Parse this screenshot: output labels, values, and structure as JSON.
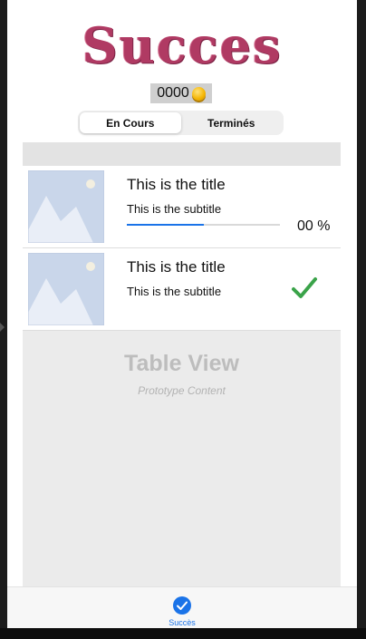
{
  "app": {
    "title": "Succes"
  },
  "coins": {
    "value": "0000",
    "icon": "coin-icon"
  },
  "segmented": {
    "items": [
      {
        "label": "En Cours",
        "active": true
      },
      {
        "label": "Terminés",
        "active": false
      }
    ]
  },
  "table": {
    "rows": [
      {
        "title": "This is the title",
        "subtitle": "This is the subtitle",
        "progress": 0.5,
        "percent_label": "00 %",
        "status": "in-progress"
      },
      {
        "title": "This is the title",
        "subtitle": "This is the subtitle",
        "status": "completed",
        "icon": "checkmark-icon"
      }
    ],
    "placeholder": {
      "title": "Table View",
      "subtitle": "Prototype Content"
    }
  },
  "tabbar": {
    "items": [
      {
        "label": "Succès",
        "icon": "check-circle-icon",
        "selected": true
      }
    ]
  },
  "colors": {
    "accent": "#1a73e8",
    "title": "#b03a63",
    "check": "#3aa349"
  }
}
